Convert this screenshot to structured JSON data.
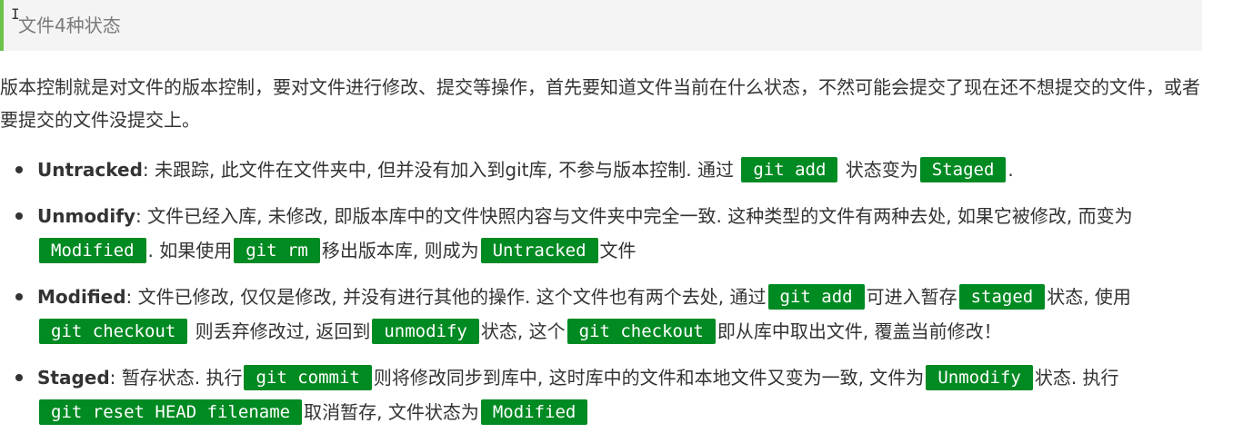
{
  "header": {
    "title": "文件4种状态"
  },
  "intro": "版本控制就是对文件的版本控制，要对文件进行修改、提交等操作，首先要知道文件当前在什么状态，不然可能会提交了现在还不想提交的文件，或者要提交的文件没提交上。",
  "states": [
    {
      "term": "Untracked",
      "t1": ": 未跟踪, 此文件在文件夹中, 但并没有加入到git库, 不参与版本控制. 通过",
      "c1": "git add",
      "t2": "状态变为",
      "c2": "Staged",
      "t3": "."
    },
    {
      "term": "Unmodify",
      "t1": ": 文件已经入库, 未修改, 即版本库中的文件快照内容与文件夹中完全一致. 这种类型的文件有两种去处, 如果它被修改, 而变为",
      "c1": "Modified",
      "t2": ". 如果使用",
      "c2": "git rm",
      "t3": "移出版本库, 则成为",
      "c3": "Untracked",
      "t4": "文件"
    },
    {
      "term": "Modified",
      "t1": ": 文件已修改, 仅仅是修改, 并没有进行其他的操作. 这个文件也有两个去处, 通过",
      "c1": "git add",
      "t2": "可进入暂存",
      "c2": "staged",
      "t3": "状态, 使用",
      "c3": "git checkout",
      "t4": "则丢弃修改过, 返回到",
      "c4": "unmodify",
      "t5": "状态, 这个",
      "c5": "git checkout",
      "t6": "即从库中取出文件, 覆盖当前修改！"
    },
    {
      "term": "Staged",
      "t1": ": 暂存状态. 执行",
      "c1": "git commit",
      "t2": "则将修改同步到库中, 这时库中的文件和本地文件又变为一致, 文件为",
      "c2": "Unmodify",
      "t3": "状态. 执行",
      "c3": "git reset HEAD filename",
      "t4": "取消暂存, 文件状态为",
      "c4": "Modified"
    }
  ]
}
